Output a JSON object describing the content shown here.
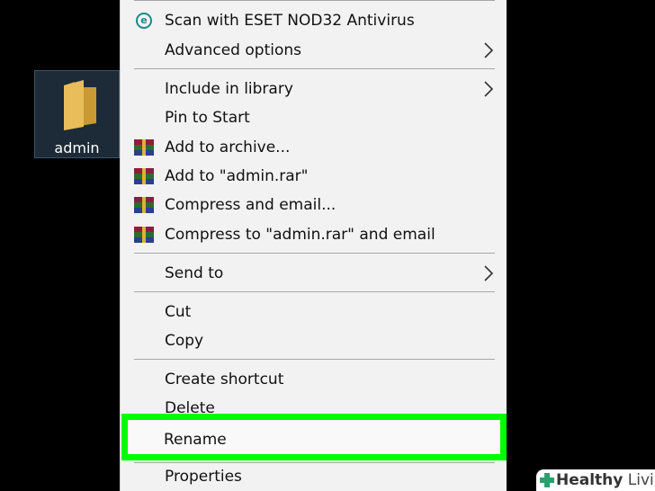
{
  "desktop": {
    "folder_label": "admin"
  },
  "context_menu": {
    "items": [
      {
        "label": "Scan with ESET NOD32 Antivirus",
        "icon": "eset-icon"
      },
      {
        "label": "Advanced options",
        "submenu": true
      },
      {
        "label": "Include in library",
        "submenu": true
      },
      {
        "label": "Pin to Start"
      },
      {
        "label": "Add to archive...",
        "icon": "winrar-icon"
      },
      {
        "label": "Add to \"admin.rar\"",
        "icon": "winrar-icon"
      },
      {
        "label": "Compress and email...",
        "icon": "winrar-icon"
      },
      {
        "label": "Compress to \"admin.rar\" and email",
        "icon": "winrar-icon"
      },
      {
        "label": "Send to",
        "submenu": true
      },
      {
        "label": "Cut"
      },
      {
        "label": "Copy"
      },
      {
        "label": "Create shortcut"
      },
      {
        "label": "Delete"
      },
      {
        "label": "Rename",
        "highlighted": true
      },
      {
        "label": "Properties"
      }
    ],
    "highlight_color": "#00ff00"
  },
  "watermark": {
    "brand_bold": "Healthy",
    "brand_light": " Living"
  }
}
